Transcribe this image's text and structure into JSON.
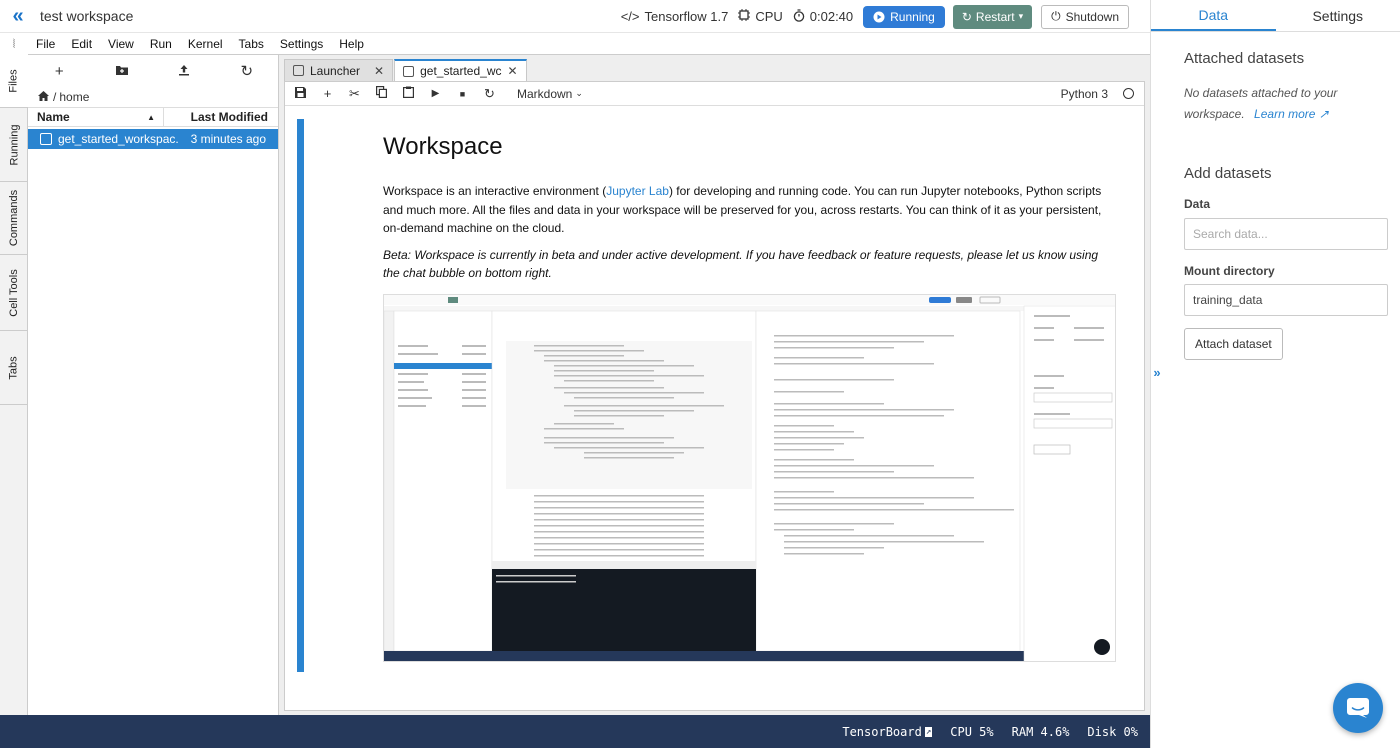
{
  "topbar": {
    "workspace_title": "test workspace",
    "framework": "Tensorflow 1.7",
    "device": "CPU",
    "timer": "0:02:40",
    "running_label": "Running",
    "restart_label": "Restart",
    "shutdown_label": "Shutdown"
  },
  "menu": [
    "File",
    "Edit",
    "View",
    "Run",
    "Kernel",
    "Tabs",
    "Settings",
    "Help"
  ],
  "left_tabs": [
    "Files",
    "Running",
    "Commands",
    "Cell Tools",
    "Tabs"
  ],
  "file_browser": {
    "breadcrumb": "home",
    "col_name": "Name",
    "col_modified": "Last Modified",
    "files": [
      {
        "name": "get_started_workspac...",
        "modified": "3 minutes ago"
      }
    ]
  },
  "doc_tabs": [
    {
      "label": "Launcher"
    },
    {
      "label": "get_started_wc"
    }
  ],
  "notebook": {
    "cell_type": "Markdown",
    "kernel": "Python 3",
    "heading": "Workspace",
    "para1_a": "Workspace is an interactive environment (",
    "para1_link": "Jupyter Lab",
    "para1_b": ") for developing and running code. You can run Jupyter notebooks, Python scripts and much more. All the files and data in your workspace will be preserved for you, across restarts. You can think of it as your persistent, on-demand machine on the cloud.",
    "para2": "Beta: Workspace is currently in beta and under active development. If you have feedback or feature requests, please let us know using the chat bubble on bottom right."
  },
  "right_panel": {
    "tab_data": "Data",
    "tab_settings": "Settings",
    "attached_title": "Attached datasets",
    "no_datasets": "No datasets attached to your workspace.",
    "learn_more": "Learn more",
    "add_title": "Add datasets",
    "data_label": "Data",
    "data_placeholder": "Search data...",
    "mount_label": "Mount directory",
    "mount_value": "training_data",
    "attach_button": "Attach dataset"
  },
  "statusbar": {
    "tensorboard": "TensorBoard",
    "cpu": "CPU 5%",
    "ram": "RAM 4.6%",
    "disk": "Disk 0%"
  },
  "colors": {
    "accent": "#2a84d0",
    "statusbar": "#25385a",
    "restart": "#5f8b7f"
  }
}
